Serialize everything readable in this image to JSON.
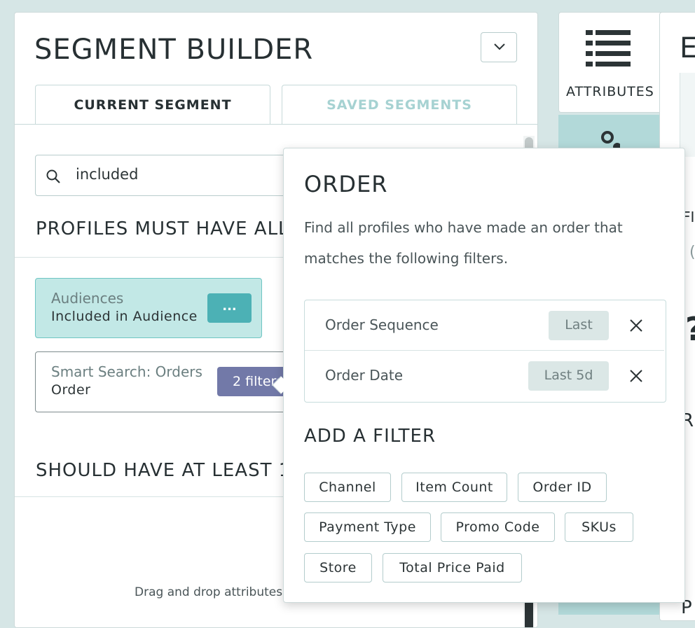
{
  "segment_builder": {
    "title": "SEGMENT BUILDER",
    "tabs": [
      {
        "label": "CURRENT SEGMENT",
        "active": true
      },
      {
        "label": "SAVED SEGMENTS",
        "active": false
      }
    ],
    "search": {
      "value": "included"
    },
    "must_have_title": "PROFILES MUST HAVE ALL",
    "should_have_title": "SHOULD HAVE AT LEAST 1 (",
    "drag_hint": "Drag and drop attributes",
    "cards": {
      "audience": {
        "title": "Audiences",
        "subtitle": "Included in Audience",
        "more_label": "..."
      },
      "smart_search": {
        "title": "Smart Search: Orders",
        "subtitle": "Order",
        "filters_badge": "2 filters"
      }
    }
  },
  "right_panel": {
    "attributes_label": "ATTRIBUTES",
    "frag_e": "E",
    "frag_fi": "FI",
    "frag_q": "(",
    "frag_big": "?",
    "frag_r": "R",
    "frag_p": "P"
  },
  "popover": {
    "title": "ORDER",
    "description": "Find all profiles who have made an order that matches the following filters.",
    "filters": [
      {
        "name": "Order Sequence",
        "value": "Last"
      },
      {
        "name": "Order Date",
        "value": "Last 5d"
      }
    ],
    "add_filter_title": "ADD A FILTER",
    "chips": [
      "Channel",
      "Item Count",
      "Order ID",
      "Payment Type",
      "Promo Code",
      "SKUs",
      "Store",
      "Total Price Paid"
    ]
  },
  "colors": {
    "teal_card": "#c2e8e6",
    "teal_button": "#4cb1b5",
    "filters_badge": "#7279a8",
    "background": "#d6e6e6"
  }
}
